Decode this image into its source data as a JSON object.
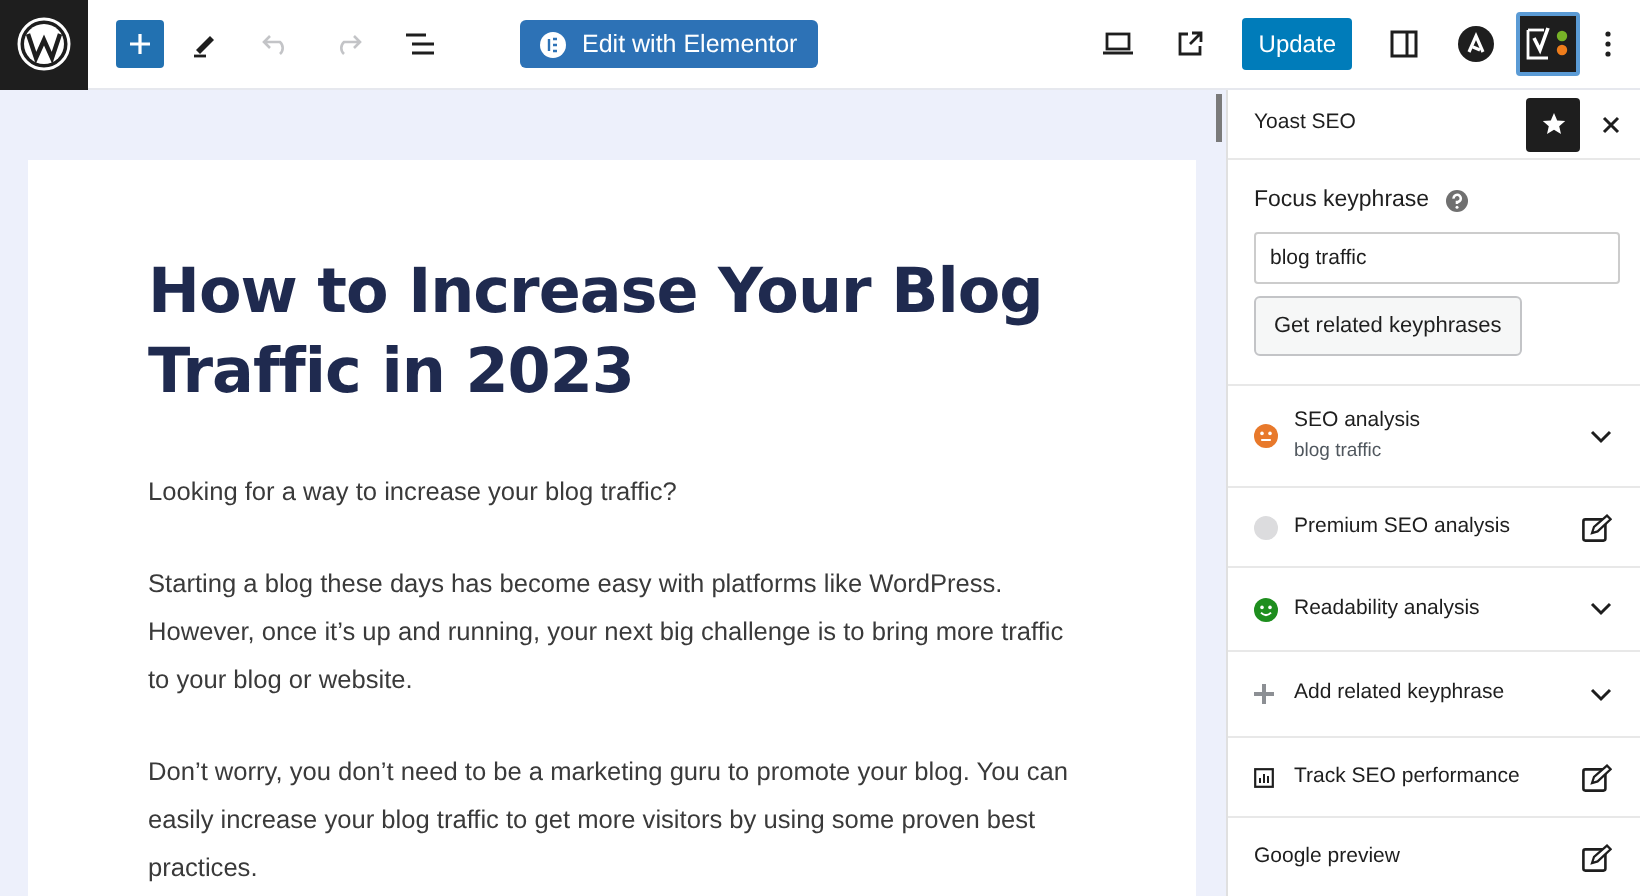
{
  "toolbar": {
    "elementor_button": "Edit with Elementor",
    "update_button": "Update",
    "sidebar_toggle_selected": true
  },
  "document": {
    "title": "How to Increase Your Blog Traffic in 2023",
    "paragraphs": [
      "Looking for a way to increase your blog traffic?",
      "Starting a blog these days has become easy with platforms like WordPress. However, once it’s up and running, your next big challenge is to bring more traffic to your blog or website.",
      "Don’t worry, you don’t need to be a marketing guru to promote your blog. You can easily increase your blog traffic to get more visitors by using some proven best practices."
    ]
  },
  "sidebar": {
    "title": "Yoast SEO",
    "focus_label": "Focus keyphrase",
    "focus_value": "blog traffic",
    "related_button": "Get related keyphrases",
    "sections": [
      {
        "kind": "seo",
        "label": "SEO analysis",
        "sublabel": "blog traffic",
        "color": "#e8792b"
      },
      {
        "kind": "premium",
        "label": "Premium SEO analysis",
        "color": "#dcdcde"
      },
      {
        "kind": "readability",
        "label": "Readability analysis",
        "color": "#1e8e1e"
      },
      {
        "kind": "related",
        "label": "Add related keyphrase"
      },
      {
        "kind": "tracking",
        "label": "Track SEO performance"
      },
      {
        "kind": "preview",
        "label": "Google preview"
      }
    ]
  }
}
